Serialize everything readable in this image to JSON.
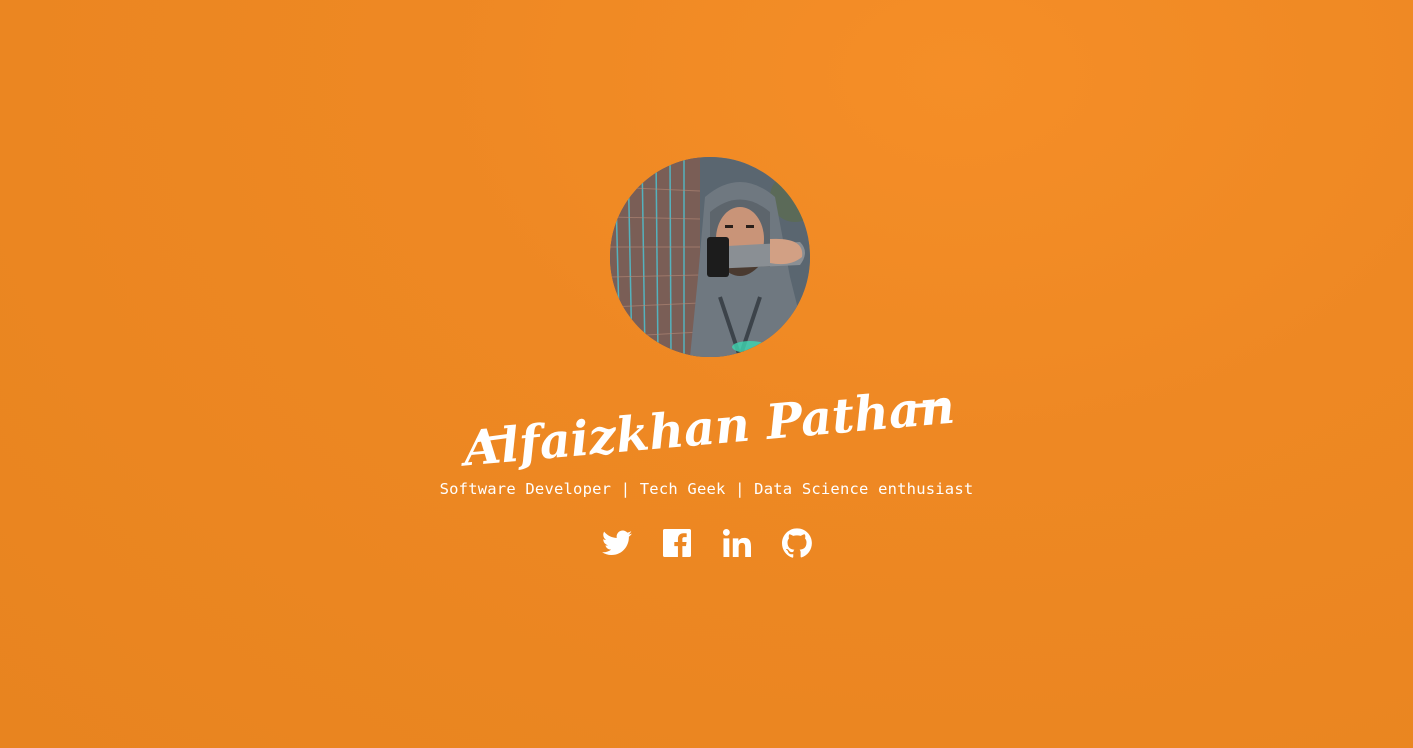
{
  "profile": {
    "name": "Alfaizkhan Pathan",
    "tagline": "Software Developer | Tech Geek | Data Science enthusiast",
    "avatar_icon": "profile-photo"
  },
  "social_links": [
    {
      "name": "twitter",
      "icon": "twitter-icon"
    },
    {
      "name": "facebook",
      "icon": "facebook-icon"
    },
    {
      "name": "linkedin",
      "icon": "linkedin-icon"
    },
    {
      "name": "github",
      "icon": "github-icon"
    }
  ],
  "colors": {
    "background": "#ee8823",
    "text": "#ffffff"
  }
}
